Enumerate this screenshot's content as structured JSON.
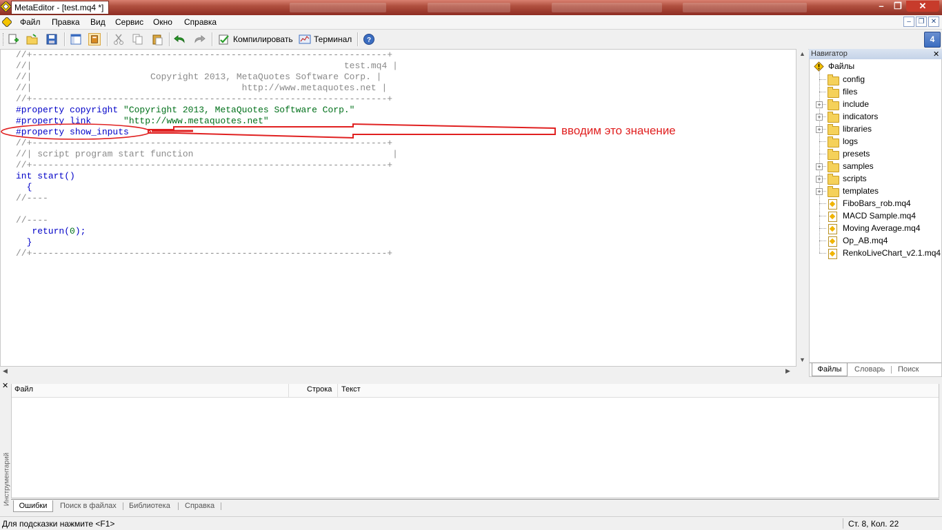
{
  "window": {
    "title": "MetaEditor - [test.mq4 *]",
    "min": "–",
    "max": "❐",
    "close": "✕"
  },
  "menu": [
    "Файл",
    "Правка",
    "Вид",
    "Сервис",
    "Окно",
    "Справка"
  ],
  "toolbar": {
    "compile_label": "Компилировать",
    "terminal_label": "Терминал"
  },
  "editor": {
    "lines": [
      {
        "segments": [
          {
            "t": "//+------------------------------------------------------------------+",
            "c": "cm"
          }
        ]
      },
      {
        "segments": [
          {
            "t": "//|                                                          test.mq4 |",
            "c": "cm"
          }
        ]
      },
      {
        "segments": [
          {
            "t": "//|                      Copyright 2013, MetaQuotes Software Corp. |",
            "c": "cm"
          }
        ]
      },
      {
        "segments": [
          {
            "t": "//|                                       http://www.metaquotes.net |",
            "c": "cm"
          }
        ]
      },
      {
        "segments": [
          {
            "t": "//+------------------------------------------------------------------+",
            "c": "cm"
          }
        ]
      },
      {
        "segments": [
          {
            "t": "#property copyright ",
            "c": "kw"
          },
          {
            "t": "\"Copyright 2013, MetaQuotes Software Corp.\"",
            "c": "str"
          }
        ]
      },
      {
        "segments": [
          {
            "t": "#property link      ",
            "c": "kw"
          },
          {
            "t": "\"http://www.metaquotes.net\"",
            "c": "str"
          }
        ]
      },
      {
        "segments": [
          {
            "t": "#property show_inputs",
            "c": "kw"
          }
        ]
      },
      {
        "segments": [
          {
            "t": "//+------------------------------------------------------------------+",
            "c": "cm"
          }
        ]
      },
      {
        "segments": [
          {
            "t": "//| script program start function                                     |",
            "c": "cm"
          }
        ]
      },
      {
        "segments": [
          {
            "t": "//+------------------------------------------------------------------+",
            "c": "cm"
          }
        ]
      },
      {
        "segments": [
          {
            "t": "int ",
            "c": "kw"
          },
          {
            "t": "start()",
            "c": "kw"
          }
        ]
      },
      {
        "segments": [
          {
            "t": "  {",
            "c": "kw"
          }
        ]
      },
      {
        "segments": [
          {
            "t": "//----",
            "c": "cm"
          }
        ]
      },
      {
        "segments": [
          {
            "t": "",
            "c": "pl"
          }
        ]
      },
      {
        "segments": [
          {
            "t": "//----",
            "c": "cm"
          }
        ]
      },
      {
        "segments": [
          {
            "t": "   return",
            "c": "kw"
          },
          {
            "t": "(",
            "c": "kw"
          },
          {
            "t": "0",
            "c": "str"
          },
          {
            "t": ");",
            "c": "kw"
          }
        ]
      },
      {
        "segments": [
          {
            "t": "  }",
            "c": "kw"
          }
        ]
      },
      {
        "segments": [
          {
            "t": "//+------------------------------------------------------------------+",
            "c": "cm"
          }
        ]
      }
    ]
  },
  "annotation": {
    "text": "вводим это значение",
    "color": "#e02020"
  },
  "navigator": {
    "title": "Навигатор",
    "root": "Файлы",
    "items": [
      {
        "label": "config",
        "kind": "folder",
        "expandable": false
      },
      {
        "label": "files",
        "kind": "folder",
        "expandable": false
      },
      {
        "label": "include",
        "kind": "folder",
        "expandable": true
      },
      {
        "label": "indicators",
        "kind": "folder",
        "expandable": true
      },
      {
        "label": "libraries",
        "kind": "folder",
        "expandable": true
      },
      {
        "label": "logs",
        "kind": "folder",
        "expandable": false
      },
      {
        "label": "presets",
        "kind": "folder",
        "expandable": false
      },
      {
        "label": "samples",
        "kind": "folder",
        "expandable": true
      },
      {
        "label": "scripts",
        "kind": "folder",
        "expandable": true
      },
      {
        "label": "templates",
        "kind": "folder",
        "expandable": true
      },
      {
        "label": "FiboBars_rob.mq4",
        "kind": "file",
        "expandable": false
      },
      {
        "label": "MACD Sample.mq4",
        "kind": "file",
        "expandable": false
      },
      {
        "label": "Moving Average.mq4",
        "kind": "file",
        "expandable": false
      },
      {
        "label": "Op_AB.mq4",
        "kind": "file",
        "expandable": false
      },
      {
        "label": "RenkoLiveChart_v2.1.mq4",
        "kind": "file",
        "expandable": false
      }
    ],
    "tabs": [
      "Файлы",
      "Словарь",
      "Поиск"
    ]
  },
  "toolbox": {
    "side_label": "Инструментарий",
    "columns": [
      "Файл",
      "Строка",
      "Текст"
    ],
    "tabs": [
      "Ошибки",
      "Поиск в файлах",
      "Библиотека",
      "Справка"
    ]
  },
  "status": {
    "hint": "Для подсказки нажмите <F1>",
    "position": "Ст. 8, Кол. 22"
  }
}
